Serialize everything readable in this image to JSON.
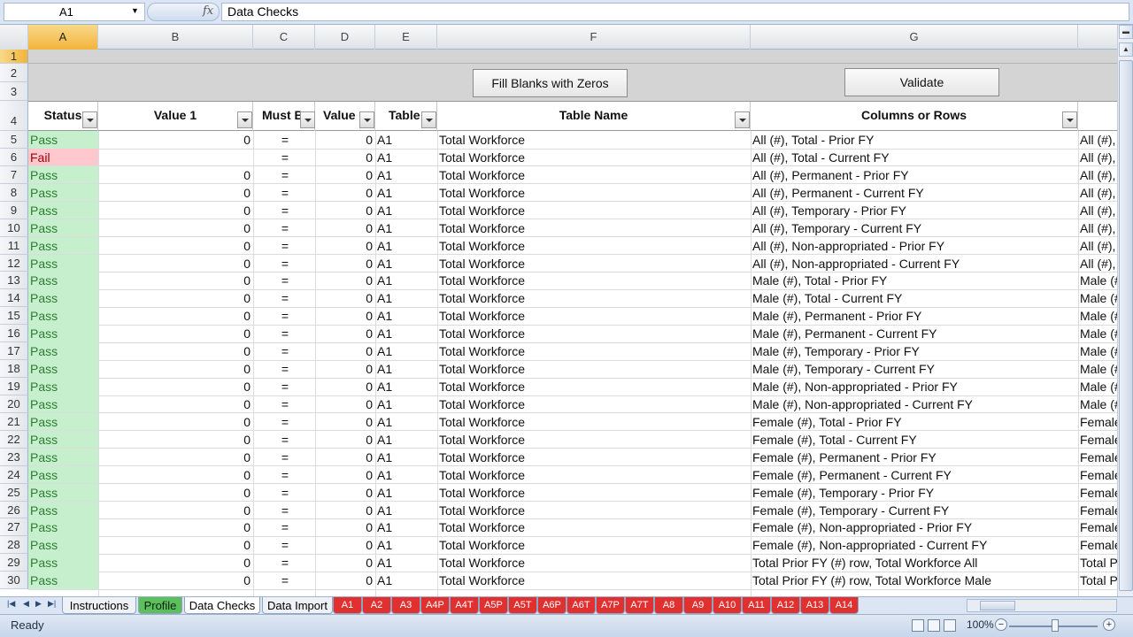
{
  "formula_bar": {
    "name_box": "A1",
    "fx": "fx",
    "formula": "Data Checks"
  },
  "columns": [
    "A",
    "B",
    "C",
    "D",
    "E",
    "F",
    "G"
  ],
  "row_labels": [
    "1",
    "2",
    "3",
    "4",
    "5",
    "6",
    "7",
    "8",
    "9",
    "10",
    "11",
    "12",
    "13",
    "14",
    "15",
    "16",
    "17",
    "18",
    "19",
    "20",
    "21",
    "22",
    "23",
    "24",
    "25",
    "26",
    "27",
    "28",
    "29",
    "30"
  ],
  "buttons": {
    "fill_blanks": "Fill Blanks with Zeros",
    "validate": "Validate"
  },
  "headers": {
    "status": "Status",
    "value1": "Value 1",
    "must_be": "Must B",
    "value2": "Value",
    "table": "Table",
    "table_name": "Table Name",
    "columns_rows": "Columns or Rows"
  },
  "colors": {
    "pass_bg": "#c6efce",
    "pass_fg": "#2e7d32",
    "fail_bg": "#ffc7ce",
    "fail_fg": "#9c0006",
    "tab_red": "#e03030",
    "tab_green": "#5bbf5b",
    "selected_header": "#f2b43a"
  },
  "rows": [
    {
      "status": "Pass",
      "v1": "0",
      "op": "=",
      "v2": "0",
      "table": "A1",
      "tname": "Total Workforce",
      "cr": "All (#), Total  - Prior FY",
      "h": "All (#), T"
    },
    {
      "status": "Fail",
      "v1": "",
      "op": "=",
      "v2": "0",
      "table": "A1",
      "tname": "Total Workforce",
      "cr": "All (#), Total  - Current FY",
      "h": "All (#), T"
    },
    {
      "status": "Pass",
      "v1": "0",
      "op": "=",
      "v2": "0",
      "table": "A1",
      "tname": "Total Workforce",
      "cr": "All (#), Permanent  - Prior FY",
      "h": "All (#), T"
    },
    {
      "status": "Pass",
      "v1": "0",
      "op": "=",
      "v2": "0",
      "table": "A1",
      "tname": "Total Workforce",
      "cr": "All (#), Permanent  - Current FY",
      "h": "All (#), T"
    },
    {
      "status": "Pass",
      "v1": "0",
      "op": "=",
      "v2": "0",
      "table": "A1",
      "tname": "Total Workforce",
      "cr": "All (#), Temporary  - Prior FY",
      "h": "All (#), T"
    },
    {
      "status": "Pass",
      "v1": "0",
      "op": "=",
      "v2": "0",
      "table": "A1",
      "tname": "Total Workforce",
      "cr": "All (#), Temporary  - Current FY",
      "h": "All (#), T"
    },
    {
      "status": "Pass",
      "v1": "0",
      "op": "=",
      "v2": "0",
      "table": "A1",
      "tname": "Total Workforce",
      "cr": "All (#), Non-appropriated - Prior FY",
      "h": "All (#), T"
    },
    {
      "status": "Pass",
      "v1": "0",
      "op": "=",
      "v2": "0",
      "table": "A1",
      "tname": "Total Workforce",
      "cr": "All (#), Non-appropriated - Current FY",
      "h": "All (#), T"
    },
    {
      "status": "Pass",
      "v1": "0",
      "op": "=",
      "v2": "0",
      "table": "A1",
      "tname": "Total Workforce",
      "cr": "Male (#), Total  - Prior FY",
      "h": "Male (#), T"
    },
    {
      "status": "Pass",
      "v1": "0",
      "op": "=",
      "v2": "0",
      "table": "A1",
      "tname": "Total Workforce",
      "cr": "Male (#), Total  - Current FY",
      "h": "Male (#), T"
    },
    {
      "status": "Pass",
      "v1": "0",
      "op": "=",
      "v2": "0",
      "table": "A1",
      "tname": "Total Workforce",
      "cr": "Male (#), Permanent  - Prior FY",
      "h": "Male (#), T"
    },
    {
      "status": "Pass",
      "v1": "0",
      "op": "=",
      "v2": "0",
      "table": "A1",
      "tname": "Total Workforce",
      "cr": "Male (#), Permanent  - Current FY",
      "h": "Male (#), T"
    },
    {
      "status": "Pass",
      "v1": "0",
      "op": "=",
      "v2": "0",
      "table": "A1",
      "tname": "Total Workforce",
      "cr": "Male (#), Temporary  - Prior FY",
      "h": "Male (#), T"
    },
    {
      "status": "Pass",
      "v1": "0",
      "op": "=",
      "v2": "0",
      "table": "A1",
      "tname": "Total Workforce",
      "cr": "Male (#), Temporary  - Current FY",
      "h": "Male (#), T"
    },
    {
      "status": "Pass",
      "v1": "0",
      "op": "=",
      "v2": "0",
      "table": "A1",
      "tname": "Total Workforce",
      "cr": "Male (#), Non-appropriated - Prior FY",
      "h": "Male (#), T"
    },
    {
      "status": "Pass",
      "v1": "0",
      "op": "=",
      "v2": "0",
      "table": "A1",
      "tname": "Total Workforce",
      "cr": "Male (#), Non-appropriated - Current FY",
      "h": "Male (#), T"
    },
    {
      "status": "Pass",
      "v1": "0",
      "op": "=",
      "v2": "0",
      "table": "A1",
      "tname": "Total Workforce",
      "cr": "Female (#), Total  - Prior FY",
      "h": "Female"
    },
    {
      "status": "Pass",
      "v1": "0",
      "op": "=",
      "v2": "0",
      "table": "A1",
      "tname": "Total Workforce",
      "cr": "Female (#), Total  - Current FY",
      "h": "Female"
    },
    {
      "status": "Pass",
      "v1": "0",
      "op": "=",
      "v2": "0",
      "table": "A1",
      "tname": "Total Workforce",
      "cr": "Female (#), Permanent  - Prior FY",
      "h": "Female"
    },
    {
      "status": "Pass",
      "v1": "0",
      "op": "=",
      "v2": "0",
      "table": "A1",
      "tname": "Total Workforce",
      "cr": "Female (#), Permanent  - Current FY",
      "h": "Female"
    },
    {
      "status": "Pass",
      "v1": "0",
      "op": "=",
      "v2": "0",
      "table": "A1",
      "tname": "Total Workforce",
      "cr": "Female (#), Temporary  - Prior FY",
      "h": "Female"
    },
    {
      "status": "Pass",
      "v1": "0",
      "op": "=",
      "v2": "0",
      "table": "A1",
      "tname": "Total Workforce",
      "cr": "Female (#), Temporary  - Current FY",
      "h": "Female"
    },
    {
      "status": "Pass",
      "v1": "0",
      "op": "=",
      "v2": "0",
      "table": "A1",
      "tname": "Total Workforce",
      "cr": "Female (#), Non-appropriated - Prior FY",
      "h": "Female"
    },
    {
      "status": "Pass",
      "v1": "0",
      "op": "=",
      "v2": "0",
      "table": "A1",
      "tname": "Total Workforce",
      "cr": "Female (#), Non-appropriated - Current FY",
      "h": "Female"
    },
    {
      "status": "Pass",
      "v1": "0",
      "op": "=",
      "v2": "0",
      "table": "A1",
      "tname": "Total Workforce",
      "cr": "Total Prior FY (#) row, Total Workforce All",
      "h": "Total Pr"
    },
    {
      "status": "Pass",
      "v1": "0",
      "op": "=",
      "v2": "0",
      "table": "A1",
      "tname": "Total Workforce",
      "cr": "Total Prior FY (#) row, Total Workforce Male",
      "h": "Total Pr"
    }
  ],
  "sheet_tabs": [
    "Instructions",
    "Profile",
    "Data Checks",
    "Data Import",
    "A1",
    "A2",
    "A3",
    "A4P",
    "A4T",
    "A5P",
    "A5T",
    "A6P",
    "A6T",
    "A7P",
    "A7T",
    "A8",
    "A9",
    "A10",
    "A11",
    "A12",
    "A13",
    "A14"
  ],
  "status_bar": {
    "status": "Ready",
    "zoom": "100%"
  }
}
